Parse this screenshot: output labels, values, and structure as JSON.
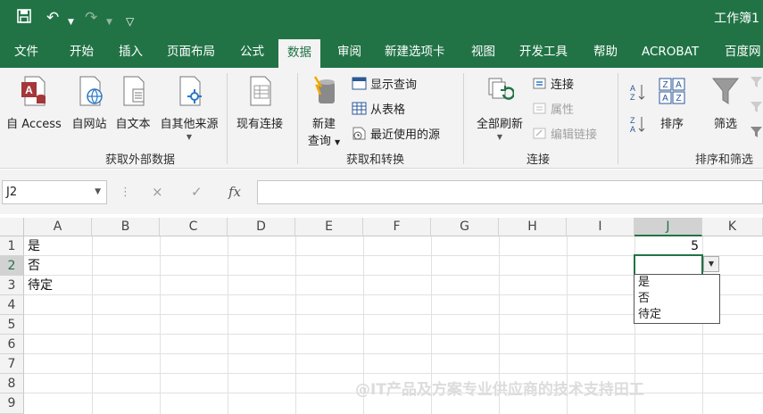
{
  "window": {
    "title": "工作簿1"
  },
  "quick_access": {
    "save_icon": "save-icon",
    "undo_icon": "undo-icon",
    "redo_icon": "redo-icon",
    "customize_icon": "customize-qat-icon"
  },
  "tabs": [
    "文件",
    "开始",
    "插入",
    "页面布局",
    "公式",
    "数据",
    "审阅",
    "新建选项卡",
    "视图",
    "开发工具",
    "帮助",
    "ACROBAT",
    "百度网"
  ],
  "active_tab": "数据",
  "ribbon": {
    "external_data": {
      "group_label": "获取外部数据",
      "buttons": [
        "自 Access",
        "自网站",
        "自文本",
        "自其他来源",
        "现有连接"
      ]
    },
    "get_transform": {
      "group_label": "获取和转换",
      "new_query": [
        "新建",
        "查询"
      ],
      "items": [
        "显示查询",
        "从表格",
        "最近使用的源"
      ]
    },
    "connections": {
      "group_label": "连接",
      "refresh_all": "全部刷新",
      "items": [
        "连接",
        "属性",
        "编辑链接"
      ]
    },
    "sort_filter": {
      "group_label": "排序和筛选",
      "sort": "排序",
      "filter": "筛选"
    }
  },
  "formula_bar": {
    "name_box": "J2",
    "cancel_icon": "×",
    "enter_icon": "✓",
    "fx": "fx",
    "formula": ""
  },
  "grid": {
    "columns": [
      "A",
      "B",
      "C",
      "D",
      "E",
      "F",
      "G",
      "H",
      "I",
      "J",
      "K"
    ],
    "rows": [
      "1",
      "2",
      "3",
      "4",
      "5",
      "6",
      "7",
      "8",
      "9"
    ],
    "cells": {
      "A1": "是",
      "A2": "否",
      "A3": "待定",
      "J1": "5"
    },
    "active_cell": "J2",
    "dropdown_options": [
      "是",
      "否",
      "待定"
    ]
  },
  "watermark": "@IT产品及方案专业供应商的技术支持田工",
  "colors": {
    "accent": "#217346",
    "ribbon_bg": "#f3f3f3"
  }
}
